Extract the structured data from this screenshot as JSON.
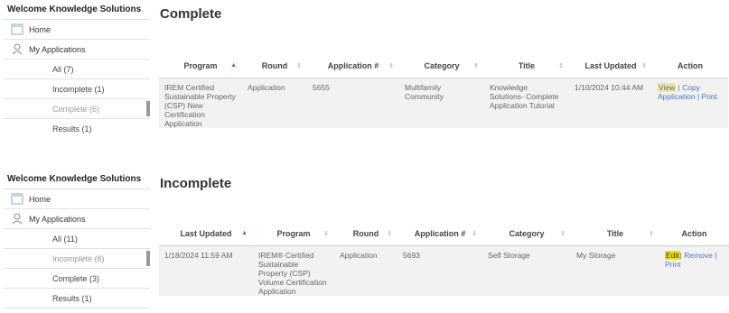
{
  "panel1": {
    "sidebar": {
      "welcome": "Welcome Knowledge Solutions",
      "home": "Home",
      "my_applications": "My Applications",
      "items": [
        "All (7)",
        "Incomplete (1)",
        "Complete (6)",
        "Results (1)"
      ]
    },
    "title": "Complete",
    "headers": [
      "Program",
      "Round",
      "Application #",
      "Category",
      "Title",
      "Last Updated",
      "Action"
    ],
    "row": {
      "program": "IREM Certified Sustainable Property (CSP) New Certification Application",
      "round": "Application",
      "application_no": "5655",
      "category": "Multifamily Community",
      "title": "Knowledge Solutions- Complete Application Tutorial",
      "last_updated": "1/10/2024 10:44 AM",
      "actions": [
        "View",
        "Copy Application",
        "Print"
      ]
    }
  },
  "panel2": {
    "sidebar": {
      "welcome": "Welcome Knowledge Solutions",
      "home": "Home",
      "my_applications": "My Applications",
      "items": [
        "All (11)",
        "Incomplete (8)",
        "Complete (3)",
        "Results (1)"
      ]
    },
    "title": "Incomplete",
    "headers": [
      "Last Updated",
      "Program",
      "Round",
      "Application #",
      "Category",
      "Title",
      "Action"
    ],
    "row": {
      "last_updated": "1/18/2024 11:59 AM",
      "program": "IREM® Certified Sustainable Property (CSP) Volume Certification Application",
      "round": "Application",
      "application_no": "5693",
      "category": "Self Storage",
      "title": "My Storage",
      "actions": [
        "Edit",
        "Remove",
        "Print"
      ]
    }
  },
  "colors": {
    "link": "#4a78c2",
    "highlight": "#f4e200"
  }
}
